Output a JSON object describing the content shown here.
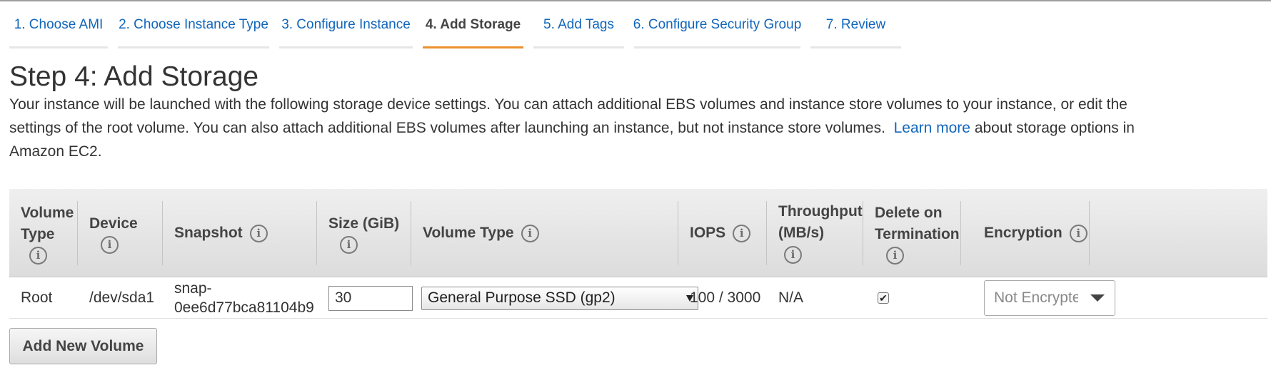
{
  "wizard": {
    "steps": [
      {
        "label": "1. Choose AMI"
      },
      {
        "label": "2. Choose Instance Type"
      },
      {
        "label": "3. Configure Instance"
      },
      {
        "label": "4. Add Storage"
      },
      {
        "label": "5. Add Tags"
      },
      {
        "label": "6. Configure Security Group"
      },
      {
        "label": "7. Review"
      }
    ],
    "active_step": "4. Add Storage"
  },
  "page": {
    "title": "Step 4: Add Storage",
    "intro_before_link": "Your instance will be launched with the following storage device settings. You can attach additional EBS volumes and instance store volumes to your instance, or edit the settings of the root volume. You can also attach additional EBS volumes after launching an instance, but not instance store volumes.",
    "learn_more": "Learn more",
    "intro_after_link": "about storage options in Amazon EC2."
  },
  "table": {
    "columns": {
      "volume_type": "Volume Type",
      "device": "Device",
      "snapshot": "Snapshot",
      "size": "Size (GiB)",
      "volume_type_select": "Volume Type",
      "iops": "IOPS",
      "throughput": "Throughput (MB/s)",
      "delete_on_termination": "Delete on Termination",
      "encryption": "Encryption"
    },
    "rows": [
      {
        "volume_type": "Root",
        "device": "/dev/sda1",
        "snapshot": "snap-0ee6d77bca81104b9",
        "size": "30",
        "volume_type_select": "General Purpose SSD (gp2)",
        "iops": "100 / 3000",
        "throughput": "N/A",
        "delete_on_termination": true,
        "encryption": "Not Encrypted"
      }
    ]
  },
  "buttons": {
    "add_new_volume": "Add New Volume"
  },
  "icons": {
    "info": "i",
    "check": "✔"
  },
  "colors": {
    "link": "#1166bb",
    "active_tab_underline": "#ec912d",
    "table_header_bg": "#e5e5e5"
  }
}
